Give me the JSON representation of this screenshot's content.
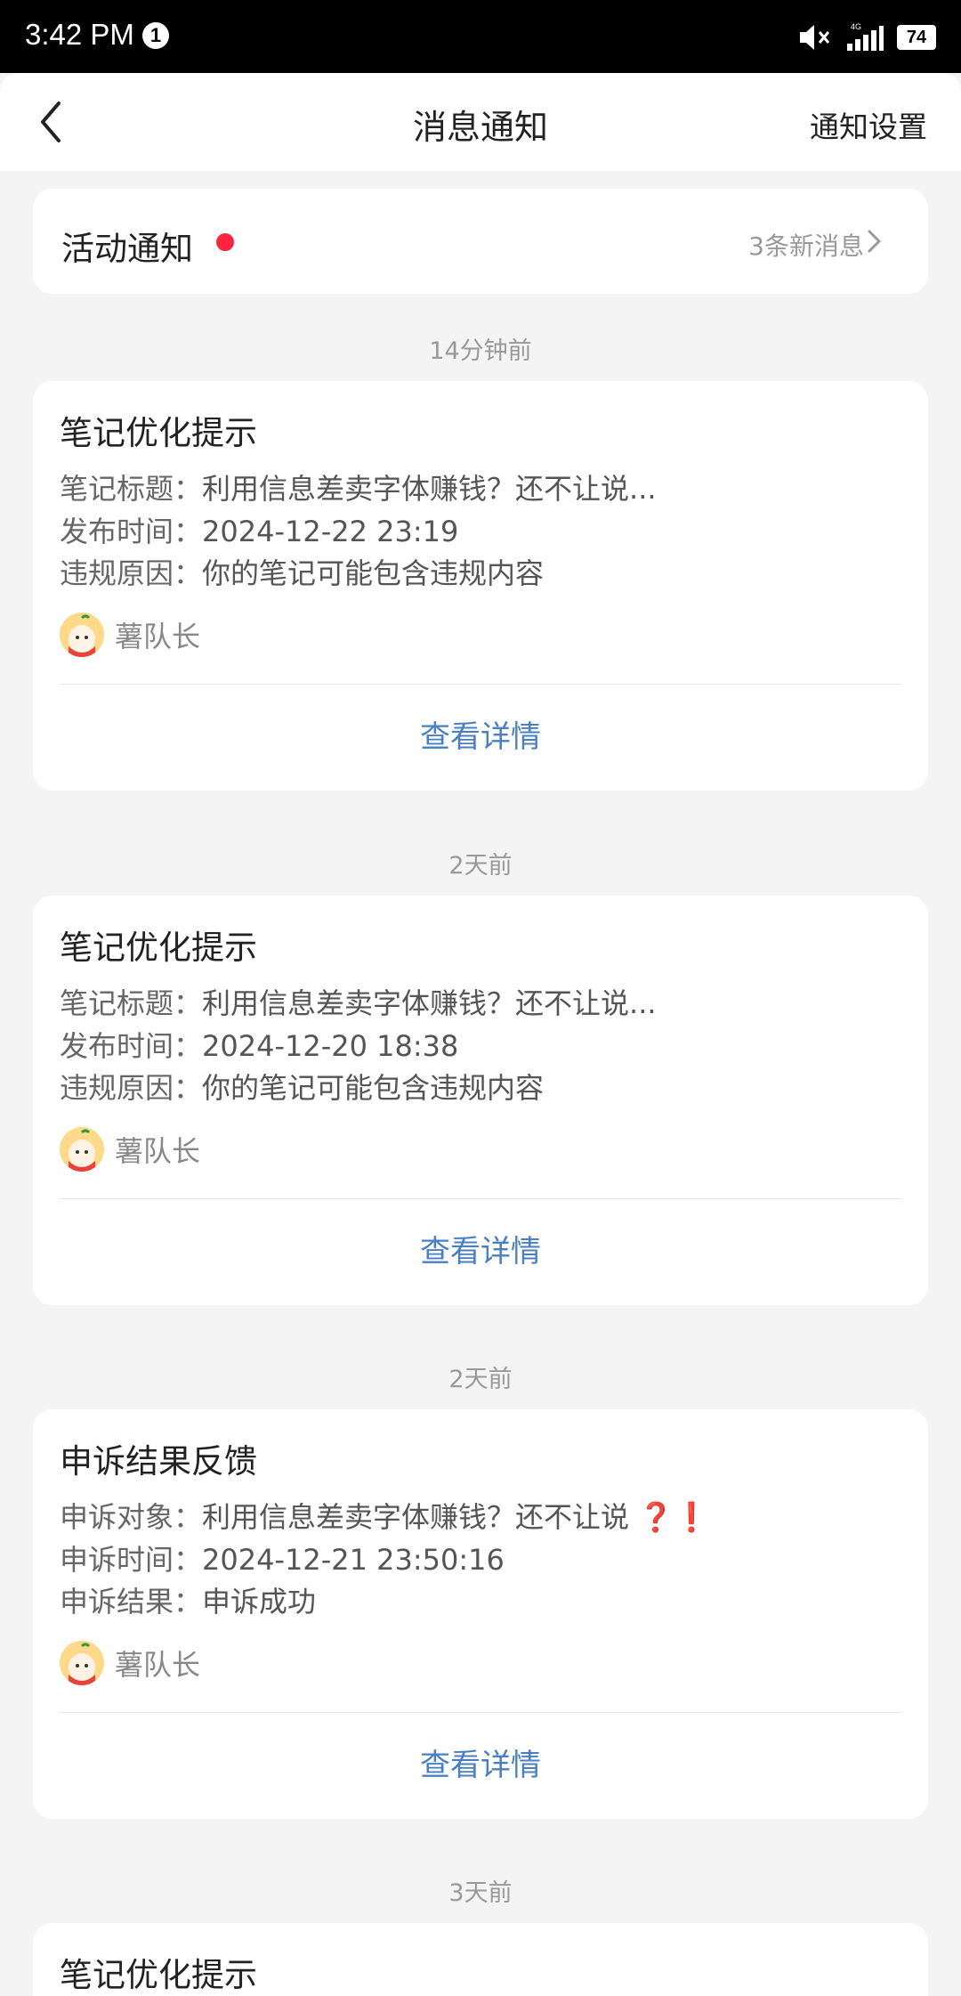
{
  "status_bar": {
    "time": "3:42 PM",
    "notification_badge": "1",
    "battery": "74"
  },
  "header": {
    "title": "消息通知",
    "settings_label": "通知设置"
  },
  "activity": {
    "title": "活动通知",
    "count_label": "3条新消息"
  },
  "notifications": [
    {
      "time": "14分钟前",
      "title": "笔记优化提示",
      "lines": [
        {
          "label": "笔记标题：",
          "value": "利用信息差卖字体赚钱？还不让说..."
        },
        {
          "label": "发布时间：",
          "value": "2024-12-22 23:19"
        },
        {
          "label": "违规原因：",
          "value": "你的笔记可能包含违规内容"
        }
      ],
      "author": "薯队长",
      "action": "查看详情"
    },
    {
      "time": "2天前",
      "title": "笔记优化提示",
      "lines": [
        {
          "label": "笔记标题：",
          "value": "利用信息差卖字体赚钱？还不让说..."
        },
        {
          "label": "发布时间：",
          "value": "2024-12-20 18:38"
        },
        {
          "label": "违规原因：",
          "value": "你的笔记可能包含违规内容"
        }
      ],
      "author": "薯队长",
      "action": "查看详情"
    },
    {
      "time": "2天前",
      "title": "申诉结果反馈",
      "lines": [
        {
          "label": "申诉对象：",
          "value": "利用信息差卖字体赚钱？还不让说",
          "suffix": "❓❗"
        },
        {
          "label": "申诉时间：",
          "value": "2024-12-21 23:50:16"
        },
        {
          "label": "申诉结果：",
          "value": "申诉成功"
        }
      ],
      "author": "薯队长",
      "action": "查看详情"
    },
    {
      "time": "3天前",
      "title": "笔记优化提示"
    }
  ],
  "icons": {
    "back": "chevron-left-icon",
    "mute": "volume-mute-icon",
    "signal": "signal-icon",
    "chevron": "chevron-right-icon"
  },
  "colors": {
    "accent_link": "#4a7fc1",
    "red_dot": "#ff2442"
  }
}
